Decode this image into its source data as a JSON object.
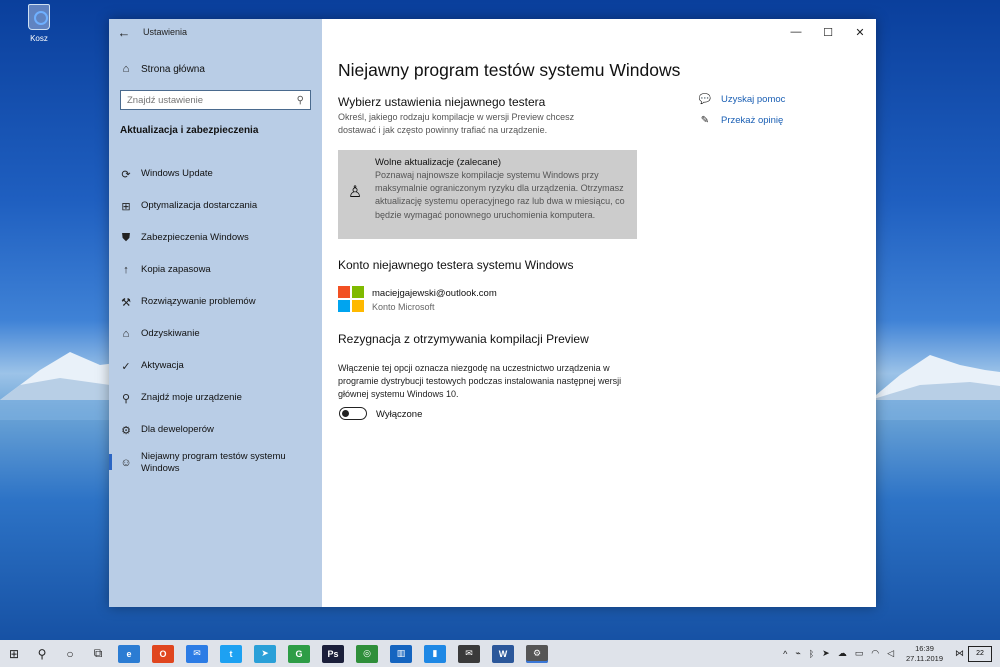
{
  "desktop": {
    "recycle_bin_label": "Kosz"
  },
  "window": {
    "app_title": "Ustawienia",
    "controls": {
      "minimize": "—",
      "maximize": "☐",
      "close": "✕"
    }
  },
  "sidebar": {
    "home_label": "Strona główna",
    "search_placeholder": "Znajdź ustawienie",
    "section_title": "Aktualizacja i zabezpieczenia",
    "items": [
      {
        "label": "Windows Update",
        "icon": "refresh-icon",
        "glyph": "⟳"
      },
      {
        "label": "Optymalizacja dostarczania",
        "icon": "delivery-icon",
        "glyph": "⊞"
      },
      {
        "label": "Zabezpieczenia Windows",
        "icon": "shield-icon",
        "glyph": "⛊"
      },
      {
        "label": "Kopia zapasowa",
        "icon": "backup-arrow-icon",
        "glyph": "↑"
      },
      {
        "label": "Rozwiązywanie problemów",
        "icon": "wrench-icon",
        "glyph": "⚒"
      },
      {
        "label": "Odzyskiwanie",
        "icon": "recovery-icon",
        "glyph": "⌂"
      },
      {
        "label": "Aktywacja",
        "icon": "check-circle-icon",
        "glyph": "✓"
      },
      {
        "label": "Znajdź moje urządzenie",
        "icon": "person-location-icon",
        "glyph": "⚲"
      },
      {
        "label": "Dla deweloperów",
        "icon": "developer-tools-icon",
        "glyph": "⚙"
      },
      {
        "label": "Niejawny program testów systemu Windows",
        "icon": "insider-icon",
        "glyph": "☺",
        "active": true
      }
    ]
  },
  "main": {
    "title": "Niejawny program testów systemu Windows",
    "tester_settings": {
      "heading": "Wybierz ustawienia niejawnego testera",
      "description": "Określ, jakiego rodzaju kompilacje w wersji Preview chcesz dostawać i jak często powinny trafiać na urządzenie.",
      "option_title": "Wolne aktualizacje (zalecane)",
      "option_text": "Poznawaj najnowsze kompilacje systemu Windows przy maksymalnie ograniczonym ryzyku dla urządzenia. Otrzymasz aktualizację systemu operacyjnego raz lub dwa w miesiącu, co będzie wymagać ponownego uruchomienia komputera."
    },
    "account": {
      "heading": "Konto niejawnego testera systemu Windows",
      "email": "maciejgajewski@outlook.com",
      "type": "Konto Microsoft"
    },
    "opt_out": {
      "heading": "Rezygnacja z otrzymywania kompilacji Preview",
      "description": "Włączenie tej opcji oznacza niezgodę na uczestnictwo urządzenia w programie dystrybucji testowych podczas instalowania następnej wersji głównej systemu Windows 10.",
      "toggle_label": "Wyłączone",
      "toggle_on": false
    },
    "help": {
      "get_help": "Uzyskaj pomoc",
      "feedback": "Przekaż opinię"
    }
  },
  "taskbar": {
    "apps": [
      {
        "name": "edge-app",
        "glyph": "e",
        "color": "#2b7cd3"
      },
      {
        "name": "office-app",
        "glyph": "O",
        "color": "#e0461f"
      },
      {
        "name": "messenger-app",
        "glyph": "✉",
        "color": "#2c7ce5"
      },
      {
        "name": "twitter-app",
        "glyph": "t",
        "color": "#1da1f2"
      },
      {
        "name": "telegram-app",
        "glyph": "➤",
        "color": "#2aa0d8"
      },
      {
        "name": "spreadsheet-app",
        "glyph": "G",
        "color": "#2e9d46"
      },
      {
        "name": "photoshop-app",
        "glyph": "Ps",
        "color": "#1b1f3a"
      },
      {
        "name": "chrome-app",
        "glyph": "◎",
        "color": "#2f8f3a"
      },
      {
        "name": "trello-app",
        "glyph": "▥",
        "color": "#1565c0"
      },
      {
        "name": "phone-app",
        "glyph": "▮",
        "color": "#1e88e5"
      },
      {
        "name": "mail-app",
        "glyph": "✉",
        "color": "#3a3a3a"
      },
      {
        "name": "word-app",
        "glyph": "W",
        "color": "#2b579a"
      },
      {
        "name": "settings-app",
        "glyph": "⚙",
        "color": "#555555",
        "active": true
      }
    ],
    "clock_time": "16:39",
    "clock_date": "27.11.2019",
    "notifications": "22"
  }
}
